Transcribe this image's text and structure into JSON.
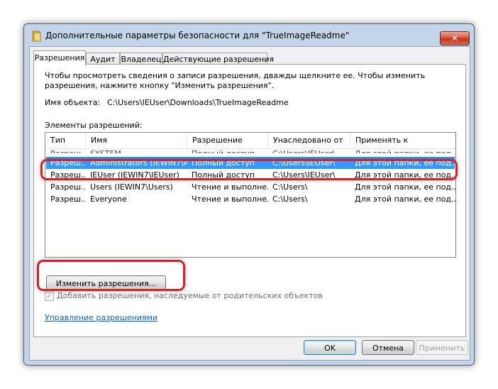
{
  "window": {
    "title": "Дополнительные параметры безопасности  для \"TrueImageReadme\"",
    "close_glyph": "✕",
    "folder_icon": "folder-icon"
  },
  "tabs": [
    {
      "label": "Разрешения",
      "active": true
    },
    {
      "label": "Аудит",
      "active": false
    },
    {
      "label": "Владелец",
      "active": false
    },
    {
      "label": "Действующие разрешения",
      "active": false
    }
  ],
  "panel": {
    "instructions": "Чтобы просмотреть сведения о записи разрешения, дважды щелкните ее. Чтобы изменить разрешения, нажмите кнопку \"Изменить разрешения\".",
    "object_name_label": "Имя объекта:",
    "object_name_value": "C:\\Users\\IEUser\\Downloads\\TrueImageReadme",
    "entries_label": "Элементы разрешений:"
  },
  "permissions_table": {
    "columns": [
      "Тип",
      "Имя",
      "Разрешение",
      "Унаследовано от",
      "Применять к"
    ],
    "rows": [
      {
        "type": "Разреш...",
        "name": "SYSTEM",
        "permission": "Полный доступ",
        "inherited": "C:\\Users\\IEUser\\",
        "apply": "Для этой папки, ее под..."
      },
      {
        "type": "Разреш...",
        "name": "Administrators (IEWIN7\\A...",
        "permission": "Полный доступ",
        "inherited": "C:\\Users\\IEUser\\",
        "apply": "Для этой папки, ее под..."
      },
      {
        "type": "Разреш...",
        "name": "IEUser (IEWIN7\\IEUser)",
        "permission": "Полный доступ",
        "inherited": "C:\\Users\\IEUser\\",
        "apply": "Для этой папки, ее под..."
      },
      {
        "type": "Разреш...",
        "name": "Users (IEWIN7\\Users)",
        "permission": "Чтение и выполне...",
        "inherited": "C:\\Users\\",
        "apply": "Для этой папки, ее под..."
      },
      {
        "type": "Разреш...",
        "name": "Everyone",
        "permission": "Чтение и выполне...",
        "inherited": "C:\\Users\\",
        "apply": "Для этой папки, ее под..."
      }
    ],
    "selected_row": 1
  },
  "buttons": {
    "change_permissions": "Изменить разрешения...",
    "ok": "OK",
    "cancel": "Отмена",
    "apply": "Применить"
  },
  "checkbox": {
    "label": "Добавить разрешения, наследуемые от родительских объектов",
    "checked": true,
    "enabled": false,
    "check_glyph": "✓"
  },
  "link": {
    "label": "Управление разрешениями"
  },
  "colors": {
    "selection": "#3399ff",
    "callout": "#d2232a",
    "link": "#0066cc"
  }
}
